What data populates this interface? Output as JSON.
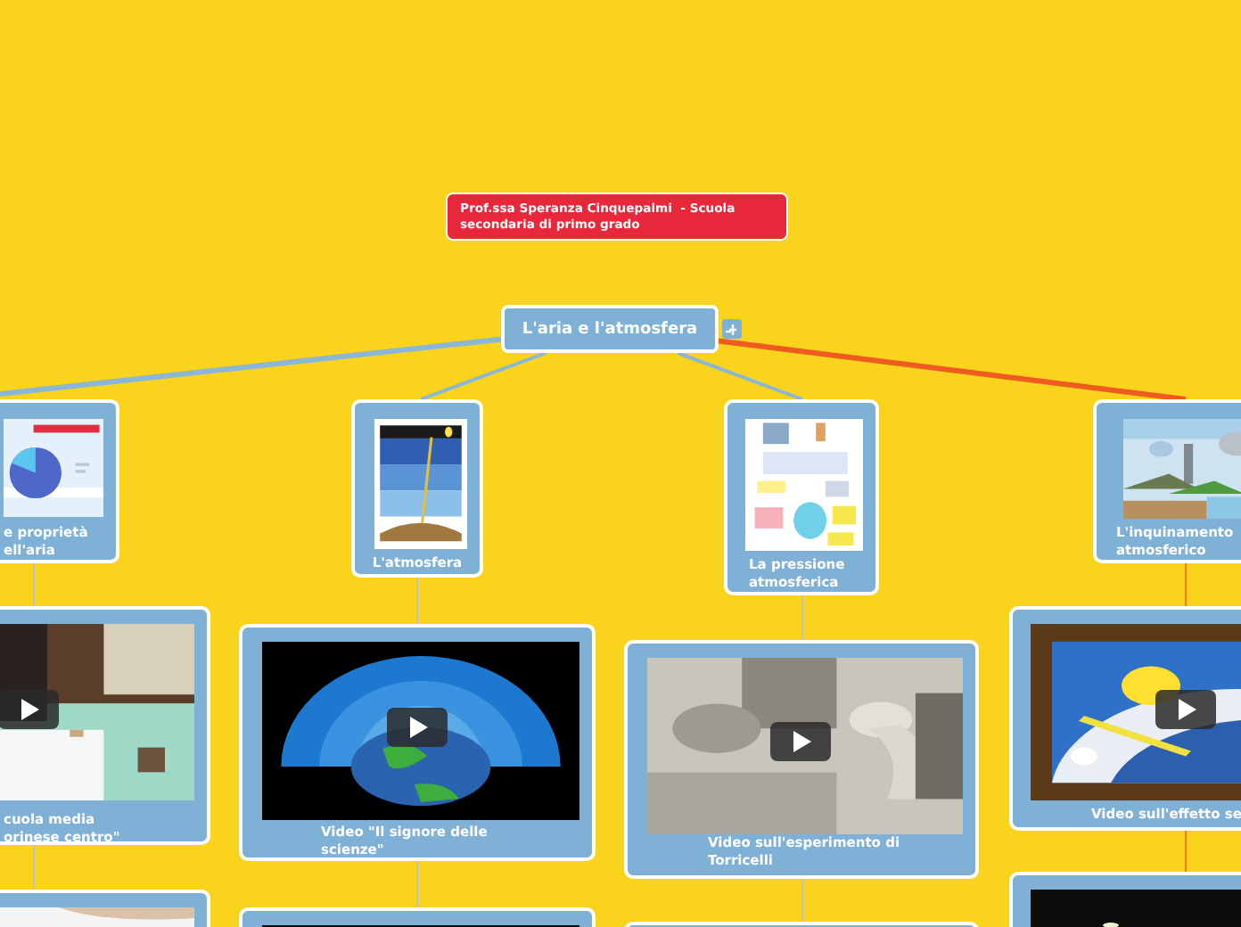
{
  "note": {
    "text": "Prof.ssa Speranza Cinquepalmi  - Scuola secondaria di primo grado"
  },
  "root": {
    "title": "L'aria e l'atmosfera"
  },
  "topics": [
    {
      "title": "e proprietà ell'aria",
      "picture": {
        "kind": "picture"
      },
      "videos": [
        {
          "kind": "video",
          "caption": "cuola media orinese centro\""
        },
        {
          "kind": "picture"
        }
      ]
    },
    {
      "title": "L'atmosfera",
      "picture": {
        "kind": "picture"
      },
      "videos": [
        {
          "kind": "video",
          "caption": "Video \"Il signore delle scienze\""
        },
        {
          "kind": "picture"
        }
      ]
    },
    {
      "title": "La pressione atmosferica",
      "picture": {
        "kind": "picture"
      },
      "videos": [
        {
          "kind": "video",
          "caption": "Video sull'esperimento di Torricelli"
        },
        {
          "kind": "card"
        }
      ]
    },
    {
      "title": "L'inquinamento atmosferico",
      "picture": {
        "kind": "picture"
      },
      "videos": [
        {
          "kind": "video",
          "caption": "Video sull'effetto se"
        },
        {
          "kind": "picture"
        }
      ]
    }
  ]
}
